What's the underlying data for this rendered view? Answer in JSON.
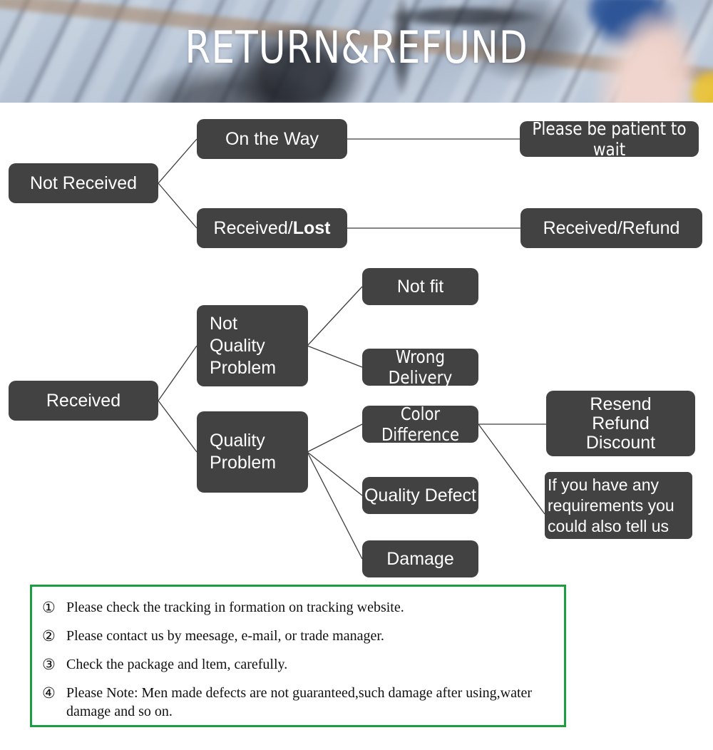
{
  "banner": {
    "title": "RETURN&REFUND",
    "title_color": "#ffffff"
  },
  "theme": {
    "node_bg": "#424242",
    "node_text": "#ffffff",
    "line_color": "#3f3f3f",
    "note_border": "#1b9e3f",
    "page_bg": "#ffffff"
  },
  "flowchart": {
    "nodes": {
      "not_received": "Not Received",
      "on_the_way": "On the Way",
      "received_lost_prefix": "Received/",
      "received_lost_bold": "Lost",
      "please_be_patient": "Please be patient to wait",
      "received_refund": "Received/Refund",
      "received": "Received",
      "not_quality_problem": "Not\nQuality\nProblem",
      "quality_problem": "Quality\nProblem",
      "not_fit": "Not fit",
      "wrong_delivery": "Wrong Delivery",
      "color_difference": "Color Difference",
      "quality_defect": "Quality Defect",
      "damage": "Damage",
      "resend_refund_discount": "Resend\nRefund\nDiscount",
      "any_requirements": "If you have any requirements you could also tell us"
    }
  },
  "notes": {
    "items": [
      {
        "marker": "①",
        "text": "Please check the tracking in formation on tracking website."
      },
      {
        "marker": "②",
        "text": "Please contact us by meesage, e-mail, or trade manager."
      },
      {
        "marker": "③",
        "text": "Check the package and ltem, carefully."
      },
      {
        "marker": "④",
        "text": "Please Note: Men made defects  are not guaranteed,such damage after using,water damage and so on."
      }
    ]
  }
}
